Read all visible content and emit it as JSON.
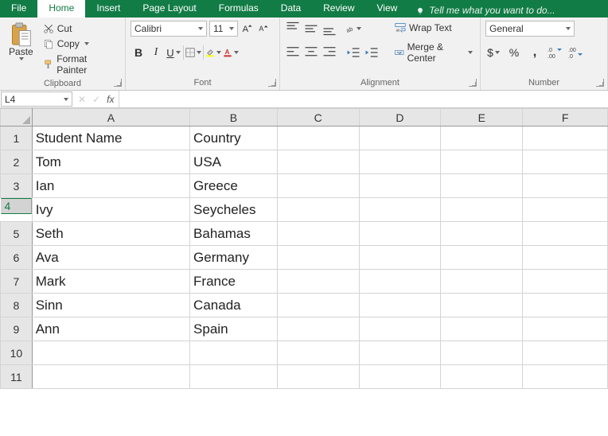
{
  "tabs": {
    "file": "File",
    "home": "Home",
    "insert": "Insert",
    "pageLayout": "Page Layout",
    "formulas": "Formulas",
    "data": "Data",
    "review": "Review",
    "view": "View",
    "tellMe": "Tell me what you want to do..."
  },
  "ribbon": {
    "clipboard": {
      "label": "Clipboard",
      "paste": "Paste",
      "cut": "Cut",
      "copy": "Copy",
      "formatPainter": "Format Painter"
    },
    "font": {
      "label": "Font",
      "name": "Calibri",
      "size": "11"
    },
    "alignment": {
      "label": "Alignment",
      "wrapText": "Wrap Text",
      "mergeCenter": "Merge & Center"
    },
    "number": {
      "label": "Number",
      "format": "General"
    }
  },
  "formulaBar": {
    "nameBox": "L4",
    "fx": "fx",
    "formula": ""
  },
  "grid": {
    "cols": [
      "A",
      "B",
      "C",
      "D",
      "E",
      "F"
    ],
    "rows": [
      "1",
      "2",
      "3",
      "4",
      "5",
      "6",
      "7",
      "8",
      "9",
      "10",
      "11"
    ],
    "selectedRow": "4",
    "data": [
      {
        "A": "Student  Name",
        "B": "Country"
      },
      {
        "A": "Tom",
        "B": "USA"
      },
      {
        "A": "Ian",
        "B": "Greece"
      },
      {
        "A": "Ivy",
        "B": "Seycheles"
      },
      {
        "A": "Seth",
        "B": "Bahamas"
      },
      {
        "A": "Ava",
        "B": "Germany"
      },
      {
        "A": "Mark",
        "B": "France"
      },
      {
        "A": "Sinn",
        "B": "Canada"
      },
      {
        "A": "Ann",
        "B": "Spain"
      },
      {
        "A": "",
        "B": ""
      },
      {
        "A": "",
        "B": ""
      }
    ]
  }
}
